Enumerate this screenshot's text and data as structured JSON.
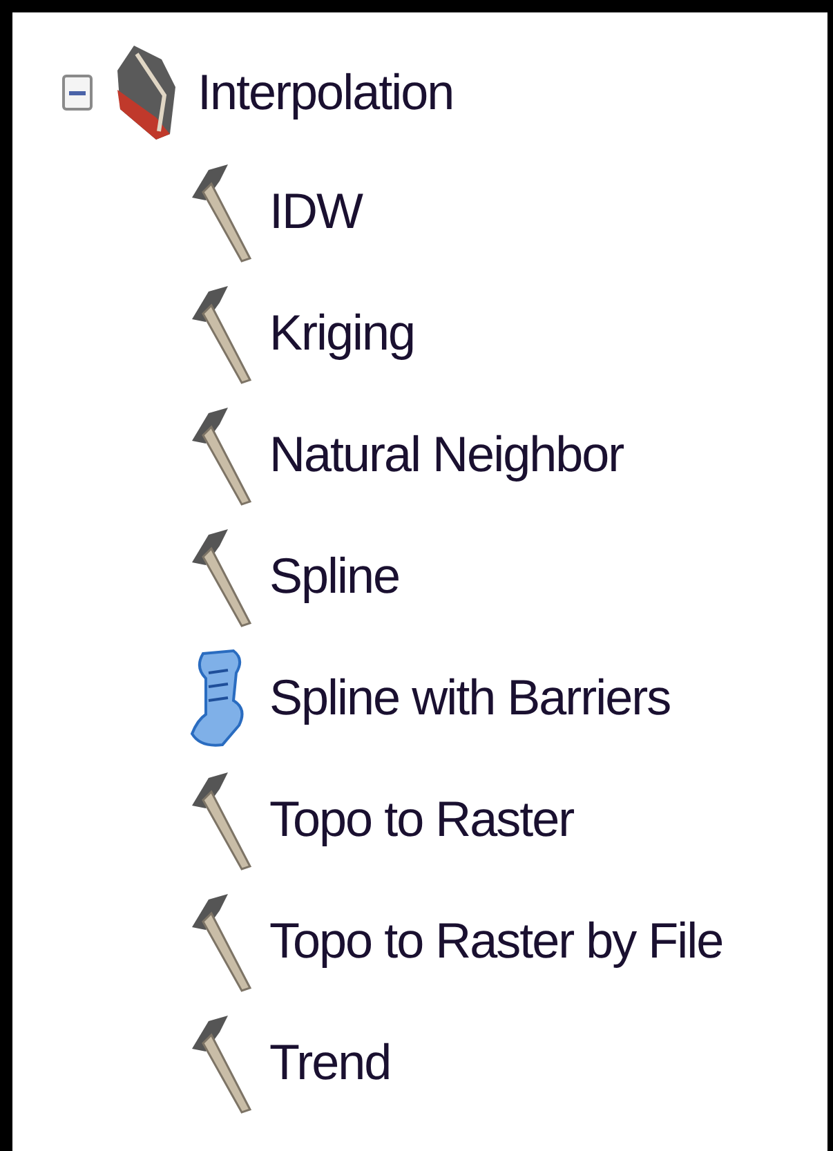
{
  "tree": {
    "label": "Interpolation",
    "kind": "toolbox",
    "expanded": true,
    "children": [
      {
        "label": "IDW",
        "kind": "tool"
      },
      {
        "label": "Kriging",
        "kind": "tool"
      },
      {
        "label": "Natural Neighbor",
        "kind": "tool"
      },
      {
        "label": "Spline",
        "kind": "tool"
      },
      {
        "label": "Spline with Barriers",
        "kind": "script"
      },
      {
        "label": "Topo to Raster",
        "kind": "tool"
      },
      {
        "label": "Topo to Raster by File",
        "kind": "tool"
      },
      {
        "label": "Trend",
        "kind": "tool"
      }
    ]
  }
}
